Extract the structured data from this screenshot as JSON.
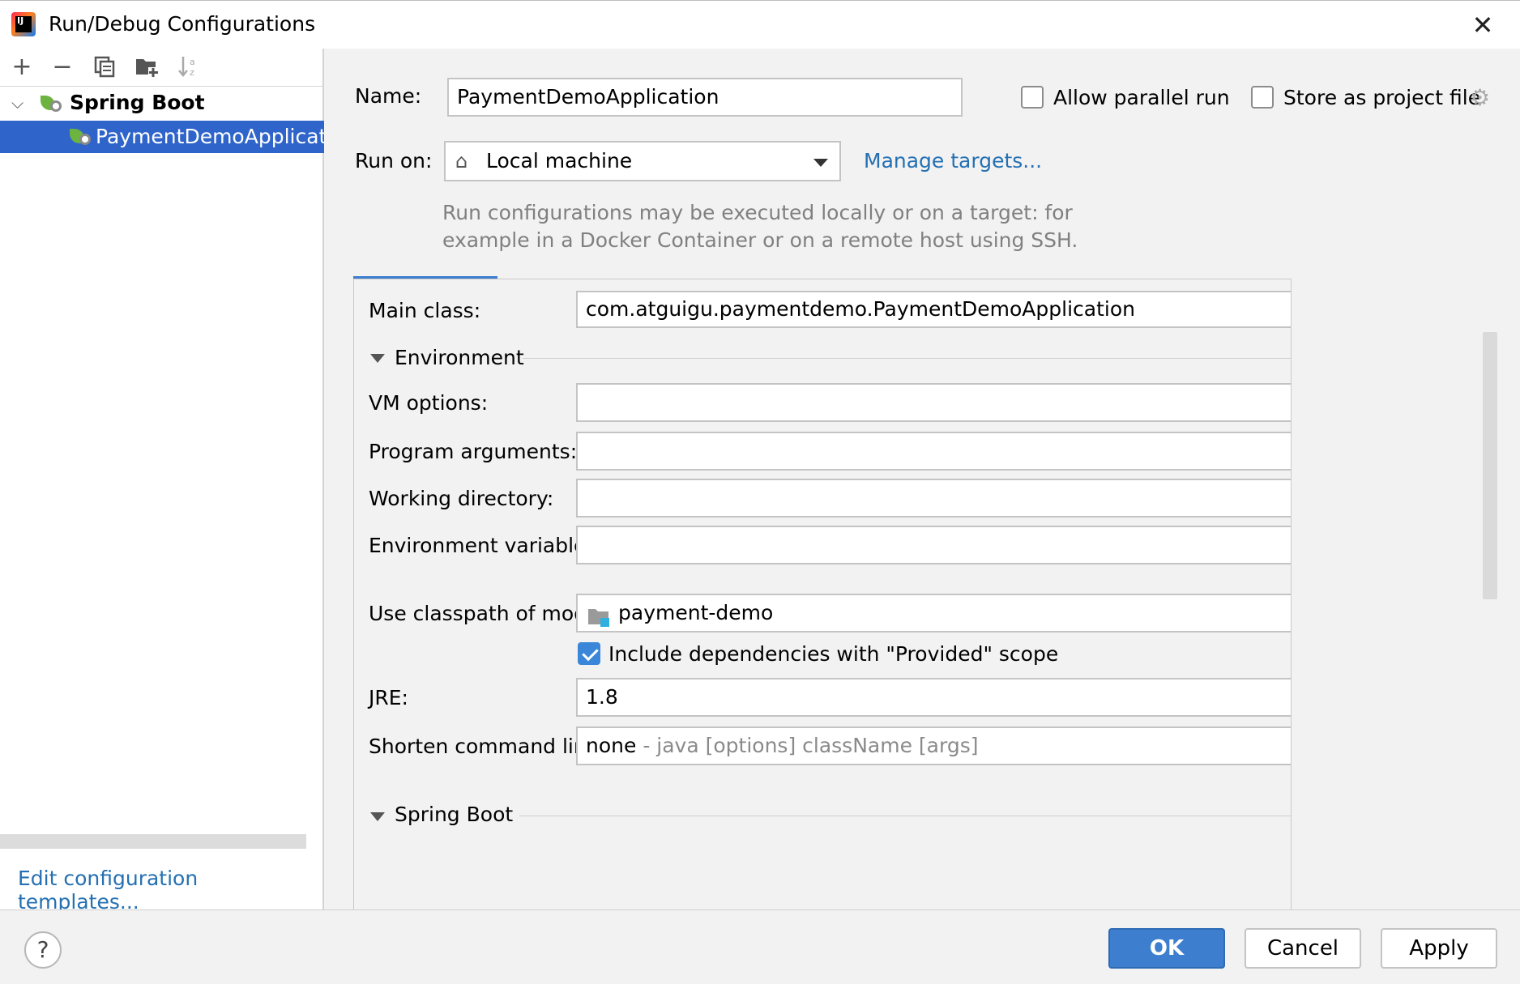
{
  "window": {
    "title": "Run/Debug Configurations",
    "logo_text": "IJ"
  },
  "toolbar": {
    "icons": [
      "add-icon",
      "remove-icon",
      "copy-icon",
      "new-folder-icon",
      "sort-icon"
    ]
  },
  "tree": {
    "group_label": "Spring Boot",
    "selected_item": "PaymentDemoApplication"
  },
  "left_footer": {
    "edit_templates": "Edit configuration templates..."
  },
  "form": {
    "name_label": "Name:",
    "name_value": "PaymentDemoApplication",
    "allow_parallel_label": "Allow parallel run",
    "allow_parallel_checked": false,
    "store_project_label": "Store as project file",
    "store_project_checked": false,
    "run_on_label": "Run on:",
    "run_on_value": "Local machine",
    "manage_targets": "Manage targets...",
    "hint_line1": "Run configurations may be executed locally or on a target: for",
    "hint_line2": "example in a Docker Container or on a remote host using SSH.",
    "main_class_label": "Main class:",
    "main_class_value": "com.atguigu.paymentdemo.PaymentDemoApplication",
    "browse_label": "...",
    "environment_section": "Environment",
    "vm_options_label": "VM options:",
    "program_args_label": "Program arguments:",
    "working_dir_label": "Working directory:",
    "env_vars_label": "Environment variables:",
    "classpath_label": "Use classpath of module:",
    "classpath_value": "payment-demo",
    "include_deps_label": "Include dependencies with \"Provided\" scope",
    "include_deps_checked": true,
    "jre_label": "JRE:",
    "jre_value": "1.8",
    "shorten_label": "Shorten command line:",
    "shorten_value": "none",
    "shorten_hint": " - java [options] className [args]",
    "spring_boot_section": "Spring Boot"
  },
  "buttons": {
    "help": "?",
    "ok": "OK",
    "cancel": "Cancel",
    "apply": "Apply"
  },
  "colors": {
    "accent": "#3d7fce",
    "selection": "#2f65ca",
    "link": "#2470b3",
    "spring_green": "#6db33f"
  }
}
